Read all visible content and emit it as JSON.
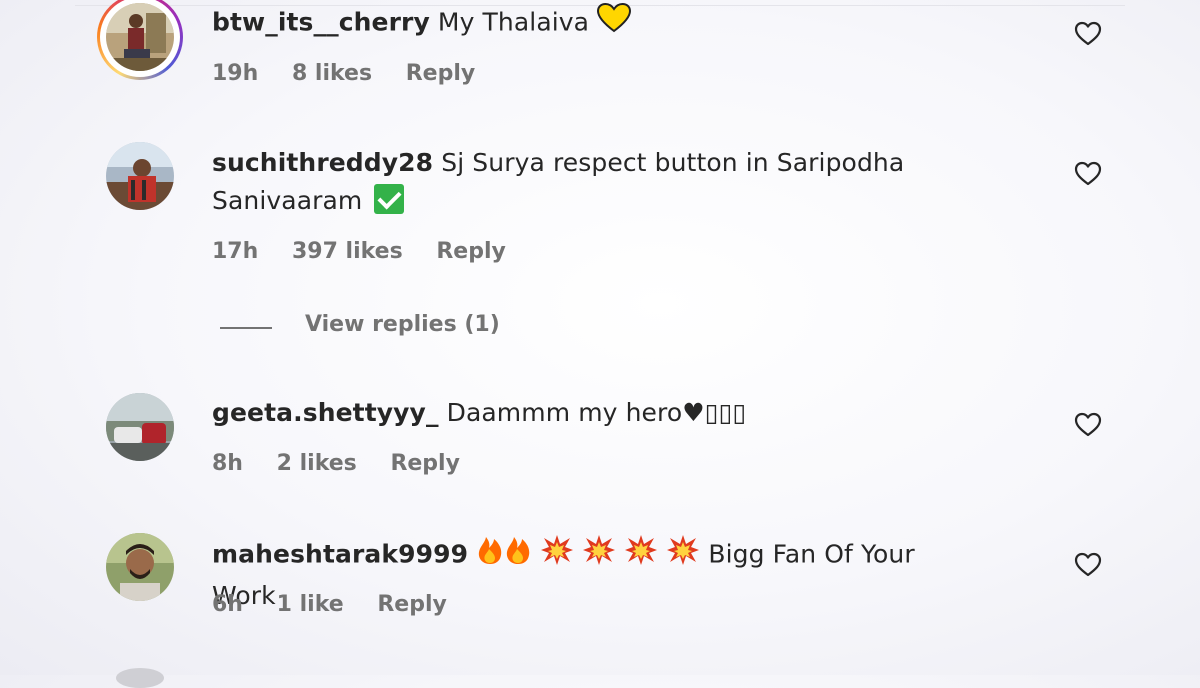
{
  "comments": [
    {
      "username": "btw_its__cherry",
      "text": "My Thalaiva",
      "emoji": "yellow-heart",
      "time": "19h",
      "likes": "8 likes",
      "reply": "Reply",
      "has_story_ring": true
    },
    {
      "username": "suchithreddy28",
      "text": "Sj Surya respect button in Saripodha Sanivaaram",
      "emoji": "check-mark-button",
      "time": "17h",
      "likes": "397 likes",
      "reply": "Reply",
      "view_replies": "View replies (1)"
    },
    {
      "username": "geeta.shettyyy_",
      "text": "Daammm my hero♥▯▯▯",
      "time": "8h",
      "likes": "2 likes",
      "reply": "Reply"
    },
    {
      "username": "maheshtarak9999",
      "emoji_prefix": [
        "fire",
        "fire",
        "collision",
        "collision",
        "collision",
        "collision"
      ],
      "text": "Bigg Fan Of Your Work",
      "time": "6h",
      "likes": "1 like",
      "reply": "Reply"
    }
  ],
  "colors": {
    "text": "#262626",
    "secondary": "#737373",
    "check_green": "#33b249",
    "heart_yellow": "#ffd600"
  },
  "icons": {
    "like": "heart-outline-icon"
  }
}
